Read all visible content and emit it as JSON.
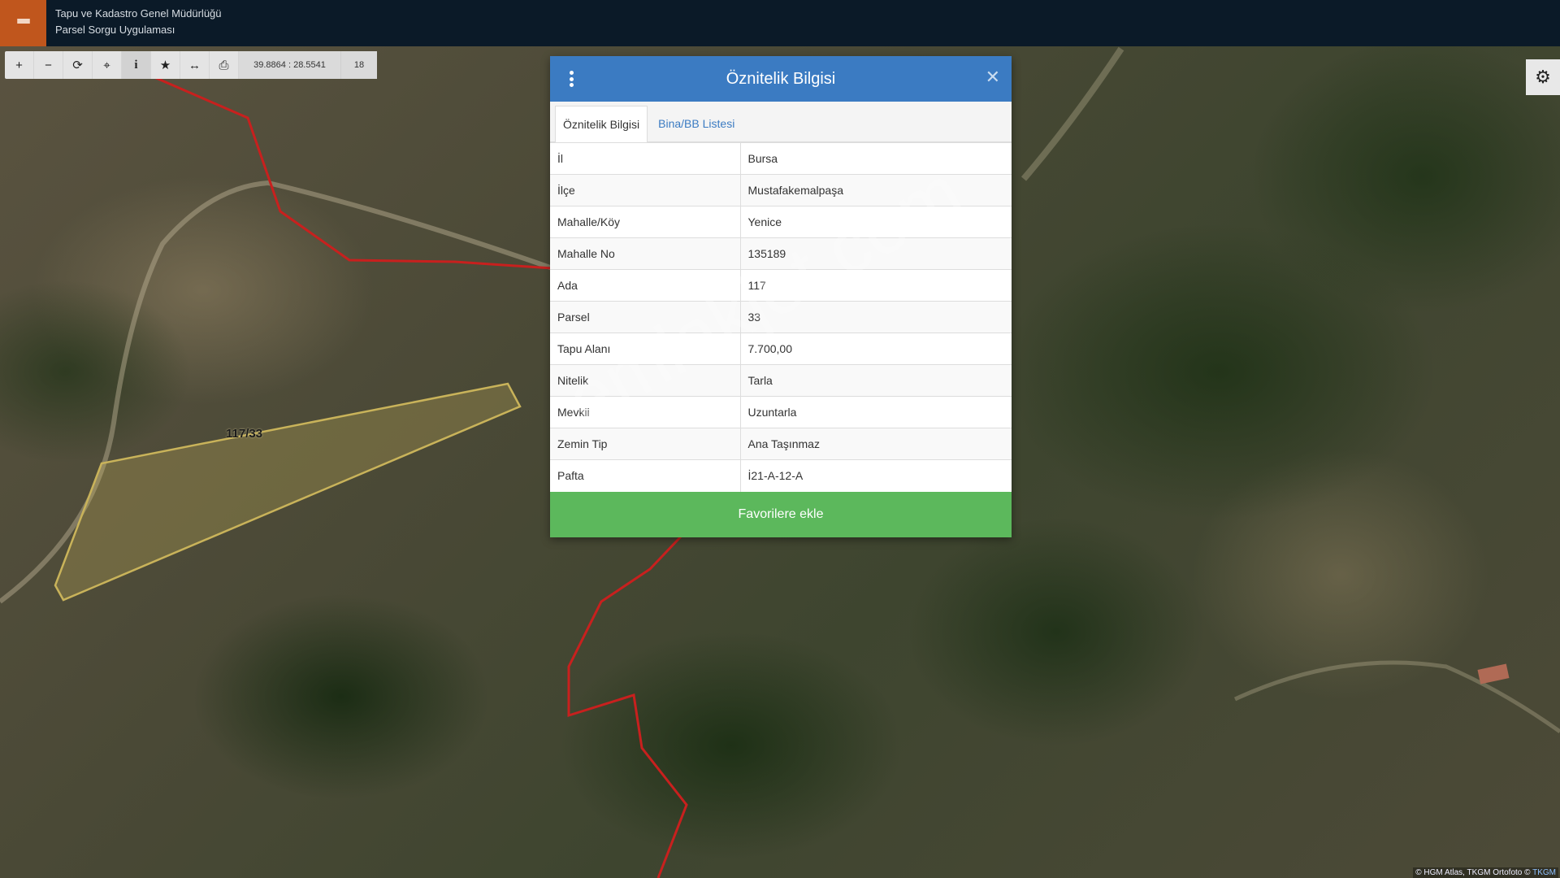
{
  "header": {
    "org_name": "Tapu ve Kadastro Genel Müdürlüğü",
    "app_name": "Parsel Sorgu Uygulaması"
  },
  "toolbar": {
    "buttons": [
      {
        "icon": "zoom-in-icon",
        "glyph": "+"
      },
      {
        "icon": "zoom-out-icon",
        "glyph": "−"
      },
      {
        "icon": "refresh-icon",
        "glyph": "⟳"
      },
      {
        "icon": "locate-icon",
        "glyph": "⌖"
      },
      {
        "icon": "info-icon",
        "glyph": "i"
      },
      {
        "icon": "star-icon",
        "glyph": "★"
      },
      {
        "icon": "measure-icon",
        "glyph": "↔"
      },
      {
        "icon": "print-icon",
        "glyph": "⎙"
      }
    ],
    "coordinates": "39.8864 : 28.5541",
    "zoom_level": "18"
  },
  "map": {
    "parcel_label": "117/33",
    "attribution_prefix": "© HGM Atlas, TKGM Ortofoto ©",
    "attribution_link": "TKGM"
  },
  "modal": {
    "title": "Öznitelik Bilgisi",
    "tabs": [
      {
        "label": "Öznitelik Bilgisi",
        "active": true
      },
      {
        "label": "Bina/BB Listesi",
        "active": false
      }
    ],
    "rows": [
      {
        "key": "İl",
        "value": "Bursa"
      },
      {
        "key": "İlçe",
        "value": "Mustafakemalpaşa"
      },
      {
        "key": "Mahalle/Köy",
        "value": "Yenice"
      },
      {
        "key": "Mahalle No",
        "value": "135189"
      },
      {
        "key": "Ada",
        "value": "117"
      },
      {
        "key": "Parsel",
        "value": "33"
      },
      {
        "key": "Tapu Alanı",
        "value": "7.700,00"
      },
      {
        "key": "Nitelik",
        "value": "Tarla"
      },
      {
        "key": "Mevkii",
        "value": "Uzuntarla"
      },
      {
        "key": "Zemin Tip",
        "value": "Ana Taşınmaz"
      },
      {
        "key": "Pafta",
        "value": "İ21-A-12-A"
      }
    ],
    "favorite_button": "Favorilere ekle"
  },
  "watermark": "emlakjet.com",
  "colors": {
    "header_bg": "#0b1a28",
    "menu_accent": "#c0561d",
    "modal_header": "#3b7bc2",
    "favorite_green": "#5cb85c",
    "boundary_red": "#c8201e",
    "parcel_outline": "#c9b35a"
  }
}
